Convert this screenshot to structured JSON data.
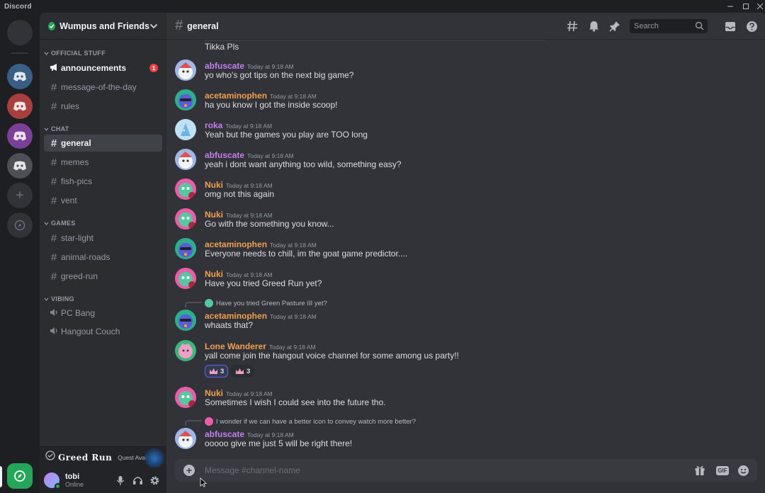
{
  "window": {
    "title": "Discord",
    "controls": [
      "minimize",
      "maximize",
      "close"
    ]
  },
  "rail": {
    "servers": [
      {
        "name": "home",
        "color": "#313338"
      },
      {
        "name": "server-blue",
        "color": "#3a5f86"
      },
      {
        "name": "server-red",
        "color": "#a83e3e"
      },
      {
        "name": "server-purple",
        "color": "#7a3f96"
      },
      {
        "name": "server-gray",
        "color": "#4e5058"
      }
    ],
    "add_label": "+",
    "discover_label": "discover",
    "active_app_color": "#23a55a"
  },
  "guild": {
    "name": "Wumpus and Friends",
    "categories": [
      {
        "label": "OFFICIAL STUFF"
      },
      {
        "label": "CHAT"
      },
      {
        "label": "GAMES"
      },
      {
        "label": "VIBING"
      }
    ],
    "channels": {
      "official": [
        {
          "label": "announcements",
          "icon": "megaphone-icon",
          "badge": "1"
        },
        {
          "label": "message-of-the-day",
          "icon": "hash-icon"
        },
        {
          "label": "rules",
          "icon": "hash-icon"
        }
      ],
      "chat": [
        {
          "label": "general",
          "icon": "hash-icon"
        },
        {
          "label": "memes",
          "icon": "hash-icon"
        },
        {
          "label": "fish-pics",
          "icon": "hash-icon"
        },
        {
          "label": "vent",
          "icon": "hash-icon"
        }
      ],
      "games": [
        {
          "label": "star-light",
          "icon": "hash-icon"
        },
        {
          "label": "animal-roads",
          "icon": "hash-icon"
        },
        {
          "label": "greed-run",
          "icon": "hash-icon"
        }
      ],
      "vibing": [
        {
          "label": "PC Bang",
          "icon": "speaker-icon"
        },
        {
          "label": "Hangout Couch",
          "icon": "speaker-icon"
        }
      ]
    }
  },
  "quest": {
    "title": "Greed Run",
    "subtitle": "Quest Available"
  },
  "user": {
    "name": "tobi",
    "status": "Online"
  },
  "header": {
    "channel": "general",
    "search_placeholder": "Search"
  },
  "messages": {
    "top_text": "Tikka Pls",
    "items": [
      {
        "author": "abfuscate",
        "color": "#c57ef0",
        "time": "Today at 9:18 AM",
        "text": "yo who's got tips on the next big game?"
      },
      {
        "author": "acetaminophen",
        "color": "#f0a050",
        "time": "Today at 9:18 AM",
        "text": "ha you know I got the inside scoop!"
      },
      {
        "author": "roka",
        "color": "#c57ef0",
        "time": "Today at 9:18 AM",
        "text": "Yeah but the games you play are TOO long"
      },
      {
        "author": "abfuscate",
        "color": "#c57ef0",
        "time": "Today at 9:18 AM",
        "text": "yeah i dont want anything too wild, something easy?"
      },
      {
        "author": "Nuki",
        "color": "#f0a050",
        "time": "Today at 9:18 AM",
        "text": "omg not this again"
      },
      {
        "author": "Nuki",
        "color": "#f0a050",
        "time": "Today at 9:18 AM",
        "text": "Go with the something you know..."
      },
      {
        "author": "acetaminophen",
        "color": "#f0a050",
        "time": "Today at 9:18 AM",
        "text": "Everyone needs to chill, im the goat game predictor...."
      },
      {
        "author": "Nuki",
        "color": "#f0a050",
        "time": "Today at 9:18 AM",
        "text": "Have you tried Greed Run yet?"
      },
      {
        "author": "acetaminophen",
        "color": "#f0a050",
        "time": "Today at 9:18 AM",
        "text": "whaats that?",
        "reply": "Have you tried Green Pasture III yet?"
      },
      {
        "author": "Lone Wanderer",
        "color": "#f0a050",
        "time": "Today at 9:18 AM",
        "text": "yall come join the hangout voice channel for some among us party!!",
        "reactions": [
          "3",
          "3"
        ]
      },
      {
        "author": "Nuki",
        "color": "#f0a050",
        "time": "Today at 9:18 AM",
        "text": "Sometimes I wish I could see into the future tho."
      },
      {
        "author": "abfuscate",
        "color": "#c57ef0",
        "time": "Today at 9:18 AM",
        "text": "ooooo give me just 5 will be right there!",
        "reply": "I wonder if we can have a better icon to convey watch more better?"
      }
    ]
  },
  "composer": {
    "placeholder": "Message #channel-name"
  }
}
